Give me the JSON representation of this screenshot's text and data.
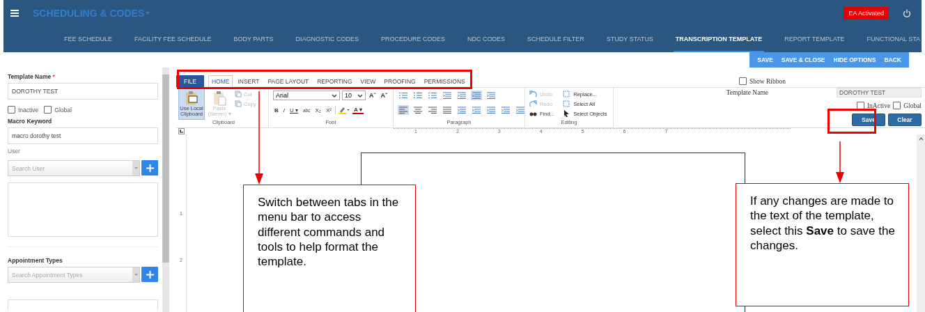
{
  "header": {
    "title": "SCHEDULING & CODES",
    "badge": "EA Activated"
  },
  "nav_tabs": [
    {
      "label": "FEE SCHEDULE",
      "selected": false
    },
    {
      "label": "FACILITY FEE SCHEDULE",
      "selected": false
    },
    {
      "label": "BODY PARTS",
      "selected": false
    },
    {
      "label": "DIAGNOSTIC CODES",
      "selected": false
    },
    {
      "label": "PROCEDURE CODES",
      "selected": false
    },
    {
      "label": "NDC CODES",
      "selected": false
    },
    {
      "label": "SCHEDULE FILTER",
      "selected": false
    },
    {
      "label": "STUDY STATUS",
      "selected": false
    },
    {
      "label": "TRANSCRIPTION TEMPLATE",
      "selected": true
    },
    {
      "label": "REPORT TEMPLATE",
      "selected": false
    },
    {
      "label": "FUNCTIONAL STA",
      "selected": false
    }
  ],
  "actions": [
    "SAVE",
    "SAVE & CLOSE",
    "HIDE OPTIONS",
    "BACK"
  ],
  "left_panel": {
    "template_name_label": "Template Name",
    "required_mark": "*",
    "template_name": "DOROTHY TEST",
    "checkboxes": [
      {
        "label": "Inactive",
        "checked": false
      },
      {
        "label": "Global",
        "checked": false
      }
    ],
    "macro_label": "Macro Keyword",
    "macro_value": "macro dorothy test",
    "user_label": "User",
    "user_placeholder": "Search User",
    "appointment_label": "Appointment Types",
    "appointment_placeholder": "Search Appointment Types"
  },
  "ribbon_tabs": [
    {
      "label": "FILE",
      "kind": "file",
      "selected": false
    },
    {
      "label": "HOME",
      "kind": "tab",
      "selected": true
    },
    {
      "label": "INSERT",
      "kind": "tab",
      "selected": false
    },
    {
      "label": "PAGE LAYOUT",
      "kind": "tab",
      "selected": false
    },
    {
      "label": "REPORTING",
      "kind": "tab",
      "selected": false
    },
    {
      "label": "VIEW",
      "kind": "tab",
      "selected": false
    },
    {
      "label": "PROOFING",
      "kind": "tab",
      "selected": false
    },
    {
      "label": "PERMISSIONS",
      "kind": "tab",
      "selected": false
    }
  ],
  "ribbon": {
    "clipboard": {
      "title": "Clipboard",
      "items": [
        {
          "label": "Use Local Clipboard",
          "kind": "large",
          "selected": true,
          "disabled": false
        },
        {
          "label": "Paste (Server) ▾",
          "kind": "large",
          "selected": false,
          "disabled": true
        },
        {
          "label": "Cut",
          "kind": "small",
          "selected": false,
          "disabled": true
        },
        {
          "label": "Copy",
          "kind": "small",
          "selected": false,
          "disabled": true
        }
      ]
    },
    "font": {
      "title": "Font",
      "family": "Arial",
      "size": "10",
      "grow_shrink": [
        "Aˆ",
        "Aˇ"
      ],
      "buttons": [
        "B",
        "I",
        "U ▾",
        "abc",
        "X₂",
        "X²"
      ],
      "color_button": "A ▾"
    },
    "paragraph": {
      "title": "Paragraph",
      "rows": [
        [
          {
            "selected": false
          },
          {
            "selected": false
          },
          {
            "selected": false
          },
          {
            "selected": false
          },
          {
            "selected": false
          },
          {
            "selected": true
          },
          {
            "selected": false
          }
        ],
        [
          {
            "selected": true
          },
          {
            "selected": false
          },
          {
            "selected": false
          },
          {
            "selected": false
          },
          {
            "selected": false
          },
          {
            "selected": false
          },
          {
            "selected": false
          },
          {
            "selected": false
          },
          {
            "selected": false
          }
        ]
      ]
    },
    "editing": {
      "title": "Editing",
      "items": [
        {
          "label": "Undo",
          "disabled": true
        },
        {
          "label": "Redo",
          "disabled": true
        },
        {
          "label": "Find...",
          "disabled": false
        },
        {
          "label": "Replace...",
          "disabled": false
        },
        {
          "label": "Select All",
          "disabled": false
        },
        {
          "label": "Select Objects",
          "disabled": false
        }
      ]
    }
  },
  "editor_options": {
    "show_ribbon": {
      "label": "Show Ribbon",
      "checked": false
    },
    "template_name_label": "Template Name",
    "template_name": "DOROTHY TEST",
    "checkboxes": [
      {
        "label": "InActive",
        "checked": false
      },
      {
        "label": "Global",
        "checked": false
      }
    ],
    "buttons": [
      "Save",
      "Clear"
    ]
  },
  "ruler_marks": [
    "1",
    "2",
    "3",
    "4",
    "5",
    "6",
    "7"
  ],
  "vertical_ruler_marks": [
    "1",
    "2"
  ],
  "callouts": [
    {
      "text": "Switch between tabs in the menu bar to access different commands and tools to help format the template."
    },
    {
      "text": "If any changes are made to the text of the template, select this **Save** to save the changes."
    }
  ]
}
